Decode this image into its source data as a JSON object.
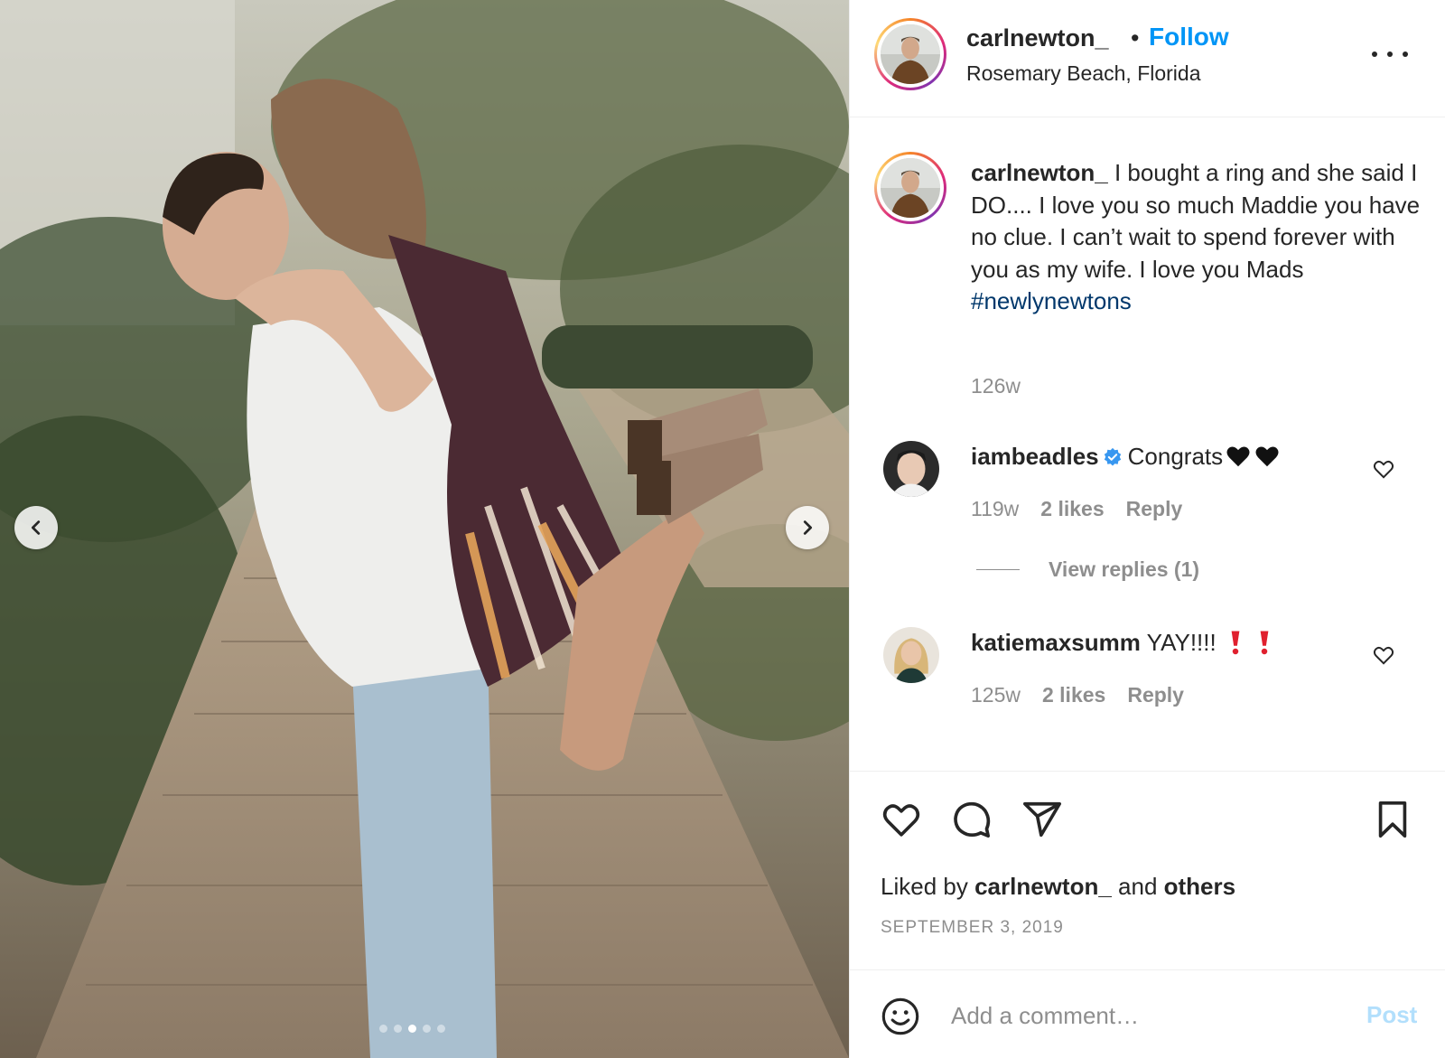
{
  "post": {
    "username": "carlnewton_",
    "separator": "•",
    "follow_label": "Follow",
    "location": "Rosemary Beach, Florida",
    "more_icon": "more-options-icon"
  },
  "photo": {
    "prev_icon": "chevron-left-icon",
    "next_icon": "chevron-right-icon",
    "carousel_count": 5,
    "carousel_active": 3
  },
  "caption": {
    "username": "carlnewton_",
    "text": " I bought a ring and she said I DO.... I love you so much Maddie you have no clue. I can’t wait to spend forever with you as my wife. I love you Mads",
    "hashtag": "#newlynewtons",
    "time": "126w"
  },
  "comments": [
    {
      "username": "iambeadles",
      "verified": true,
      "text": "Congrats",
      "emoji": [
        "black-heart",
        "black-heart"
      ],
      "time": "119w",
      "likes": "2 likes",
      "reply_label": "Reply"
    },
    {
      "username": "katiemaxsumm",
      "verified": false,
      "text": "YAY!!!!",
      "emoji": [
        "red-exclamation",
        "red-exclamation"
      ],
      "time": "125w",
      "likes": "2 likes",
      "reply_label": "Reply"
    }
  ],
  "view_replies": "View replies (1)",
  "actions": {
    "liked_prefix": "Liked by ",
    "liked_user": "carlnewton_",
    "liked_middle": " and ",
    "liked_others": "others",
    "date": "SEPTEMBER 3, 2019"
  },
  "comment_box": {
    "placeholder": "Add a comment…",
    "post_label": "Post"
  },
  "colors": {
    "link_blue": "#0095f6",
    "hashtag_blue": "#00376b",
    "muted": "#8e8e8e",
    "post_disabled": "#b2dffc",
    "text": "#262626"
  }
}
